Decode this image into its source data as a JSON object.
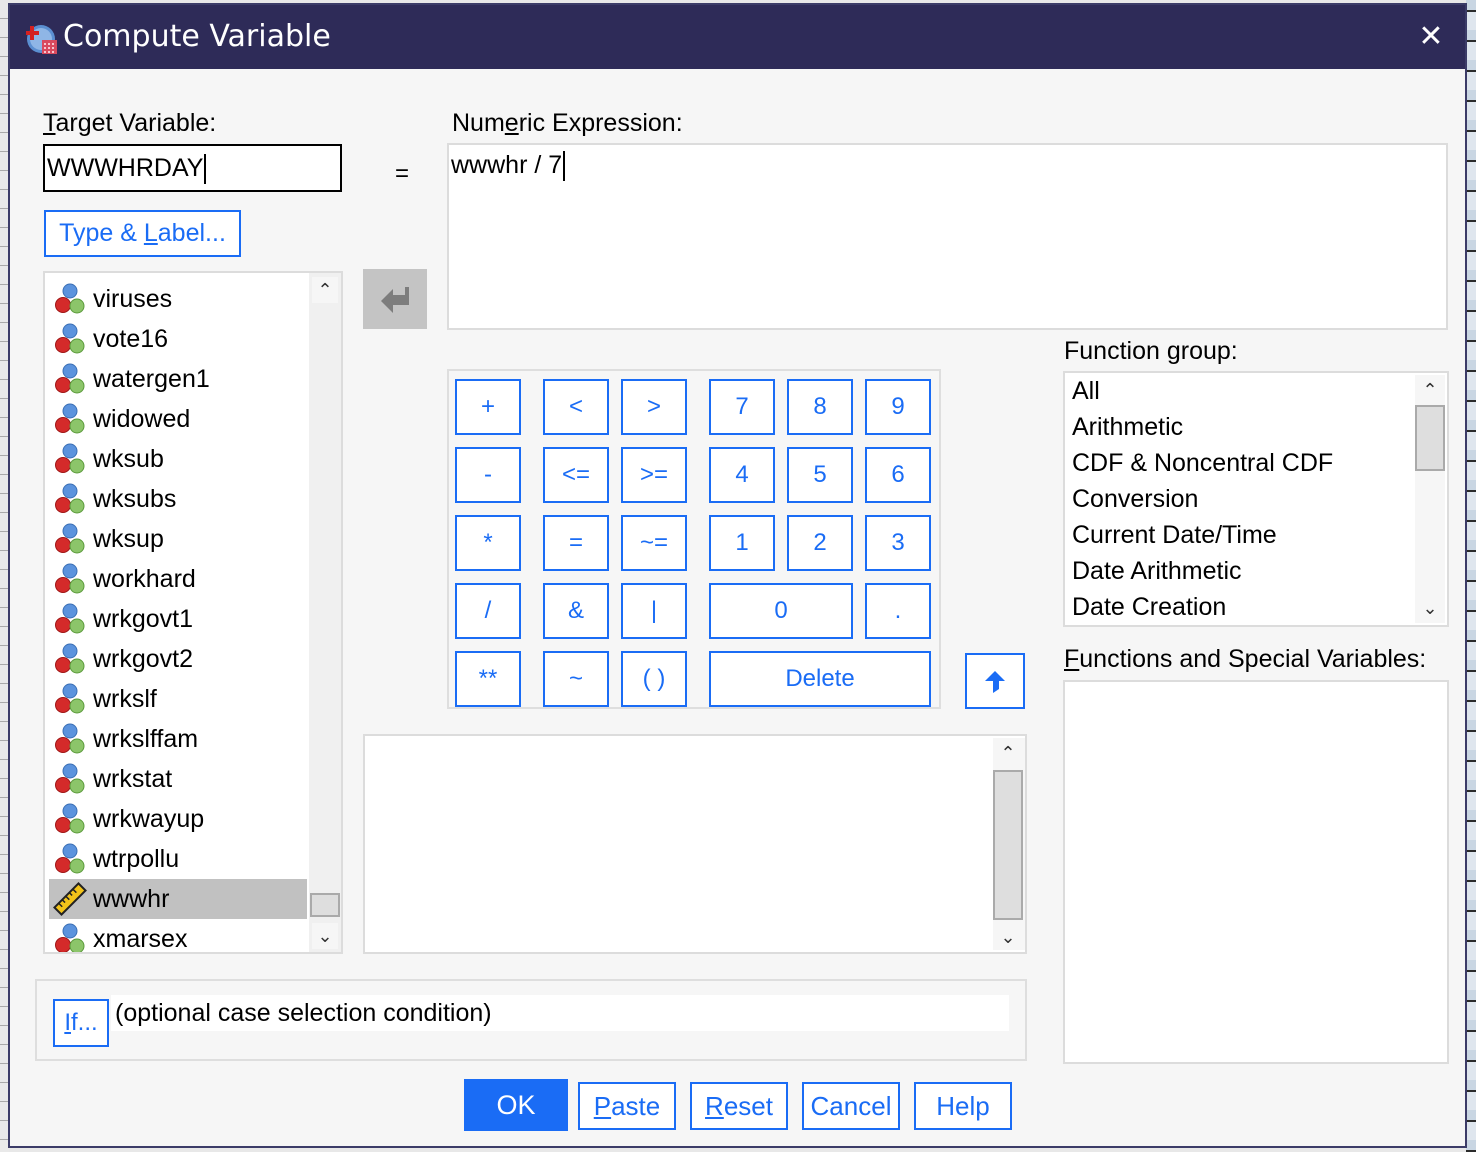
{
  "window": {
    "title": "Compute Variable",
    "app_icon": "spss-compute-icon",
    "close_icon": "close-icon",
    "close_glyph": "✕"
  },
  "target": {
    "label_first": "T",
    "label_rest": "arget Variable:",
    "value": "WWWHRDAY",
    "equals": "="
  },
  "type_label_button": {
    "pre": "Type & ",
    "u": "L",
    "post": "abel..."
  },
  "expression": {
    "label_pre": "Num",
    "label_u": "e",
    "label_post": "ric Expression:",
    "value": "wwwhr / 7"
  },
  "variables": {
    "items": [
      {
        "name": "viruses",
        "type": "nominal"
      },
      {
        "name": "vote16",
        "type": "nominal"
      },
      {
        "name": "watergen1",
        "type": "nominal"
      },
      {
        "name": "widowed",
        "type": "nominal"
      },
      {
        "name": "wksub",
        "type": "nominal"
      },
      {
        "name": "wksubs",
        "type": "nominal"
      },
      {
        "name": "wksup",
        "type": "nominal"
      },
      {
        "name": "workhard",
        "type": "nominal"
      },
      {
        "name": "wrkgovt1",
        "type": "nominal"
      },
      {
        "name": "wrkgovt2",
        "type": "nominal"
      },
      {
        "name": "wrkslf",
        "type": "nominal"
      },
      {
        "name": "wrkslffam",
        "type": "nominal"
      },
      {
        "name": "wrkstat",
        "type": "nominal"
      },
      {
        "name": "wrkwayup",
        "type": "nominal"
      },
      {
        "name": "wtrpollu",
        "type": "nominal"
      },
      {
        "name": "wwwhr",
        "type": "scale",
        "selected": true
      },
      {
        "name": "xmarsex",
        "type": "nominal"
      }
    ]
  },
  "keypad": {
    "keys": [
      {
        "label": "+",
        "name": "key-plus"
      },
      {
        "label": "<",
        "name": "key-less-than"
      },
      {
        "label": ">",
        "name": "key-greater-than"
      },
      {
        "label": "7",
        "name": "key-7"
      },
      {
        "label": "8",
        "name": "key-8"
      },
      {
        "label": "9",
        "name": "key-9"
      },
      {
        "label": "-",
        "name": "key-minus"
      },
      {
        "label": "<=",
        "name": "key-less-equal"
      },
      {
        "label": ">=",
        "name": "key-greater-equal"
      },
      {
        "label": "4",
        "name": "key-4"
      },
      {
        "label": "5",
        "name": "key-5"
      },
      {
        "label": "6",
        "name": "key-6"
      },
      {
        "label": "*",
        "name": "key-multiply"
      },
      {
        "label": "=",
        "name": "key-equal"
      },
      {
        "label": "~=",
        "name": "key-not-equal"
      },
      {
        "label": "1",
        "name": "key-1"
      },
      {
        "label": "2",
        "name": "key-2"
      },
      {
        "label": "3",
        "name": "key-3"
      },
      {
        "label": "/",
        "name": "key-divide"
      },
      {
        "label": "&",
        "name": "key-and"
      },
      {
        "label": "|",
        "name": "key-or"
      },
      {
        "label": "0",
        "name": "key-0"
      },
      {
        "label": ".",
        "name": "key-decimal"
      },
      {
        "label": "**",
        "name": "key-power"
      },
      {
        "label": "~",
        "name": "key-not"
      },
      {
        "label": "( )",
        "name": "key-parentheses"
      },
      {
        "label": "Delete",
        "name": "key-delete"
      }
    ]
  },
  "function_group": {
    "label_pre": "Function ",
    "label_u": "g",
    "label_post": "roup:",
    "items": [
      "All",
      "Arithmetic",
      "CDF & Noncentral CDF",
      "Conversion",
      "Current Date/Time",
      "Date Arithmetic",
      "Date Creation"
    ]
  },
  "functions": {
    "label_u": "F",
    "label_post": "unctions and Special Variables:",
    "items": []
  },
  "if_condition": {
    "button_u": "I",
    "button_post": "f...",
    "text": "(optional case selection condition)"
  },
  "footer": {
    "ok": "OK",
    "paste_u": "P",
    "paste_post": "aste",
    "reset_u": "R",
    "reset_post": "eset",
    "cancel": "Cancel",
    "help": "Help"
  },
  "colors": {
    "titlebar": "#2e2b58",
    "accent": "#1a6cf5",
    "selection": "#c1c1c1"
  }
}
